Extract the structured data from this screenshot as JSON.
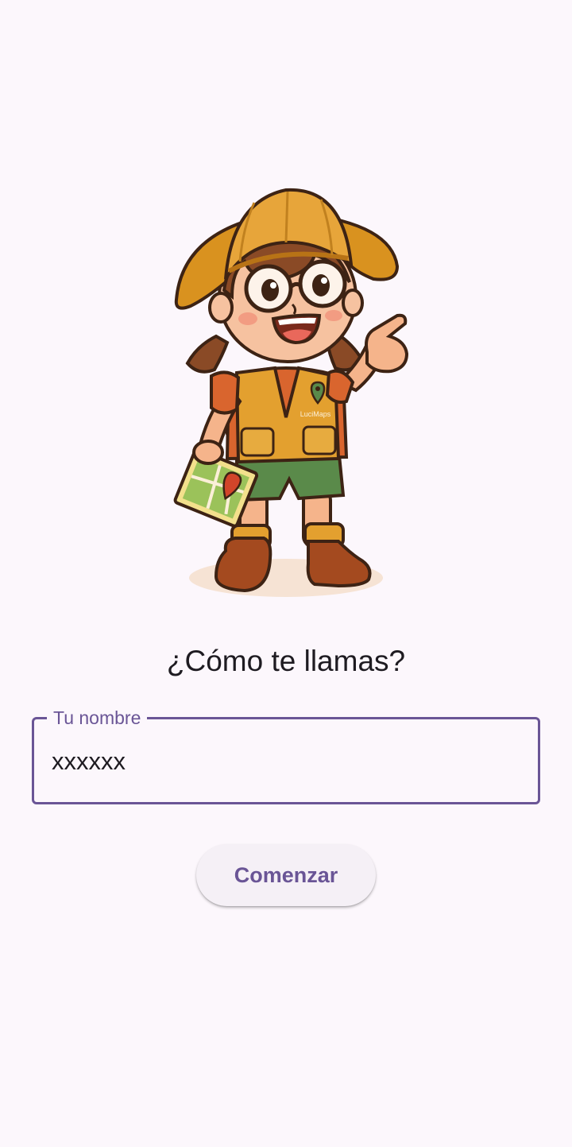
{
  "illustration": {
    "icon": "explorer-girl-icon",
    "vest_logo": "LuciMaps"
  },
  "prompt": {
    "title": "¿Cómo te llamas?"
  },
  "name_field": {
    "label": "Tu nombre",
    "value": "xxxxxx"
  },
  "actions": {
    "start_label": "Comenzar"
  },
  "colors": {
    "background": "#fcf7fc",
    "accent": "#6a5596",
    "text": "#1e1b21",
    "button_surface": "#f5f0f6"
  }
}
